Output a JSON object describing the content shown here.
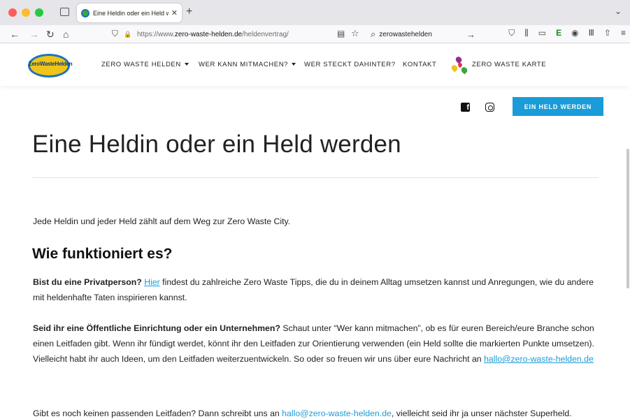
{
  "browser": {
    "tab_title": "Eine Heldin oder ein Held werde",
    "tab_close": "✕",
    "new_tab": "+",
    "tab_list": "⌄",
    "url_prefix": "https://www.",
    "url_domain": "zero-waste-helden.de",
    "url_path": "/heldenvertrag/",
    "search_text": "zerowastehelden",
    "nav_icons": {
      "back": "←",
      "forward": "→",
      "reload": "↻",
      "home": "⌂",
      "shield": "⛉",
      "lock": "🔒",
      "reader": "▤",
      "star": "☆",
      "search": "⌕",
      "go": "→"
    },
    "right_icons": [
      "⛉",
      "⫼",
      "▭",
      "E",
      "◉",
      "Ⅲ",
      "⇧",
      "≡"
    ]
  },
  "site": {
    "logo_text": "ZeroWasteHelden",
    "menu": [
      {
        "label": "ZERO WASTE HELDEN",
        "has_caret": true
      },
      {
        "label": "WER KANN MITMACHEN?",
        "has_caret": true
      },
      {
        "label": "WER STECKT DAHINTER?",
        "has_caret": false
      },
      {
        "label": "KONTAKT",
        "has_caret": false
      },
      {
        "label": "ZERO WASTE KARTE",
        "has_caret": false
      }
    ],
    "map_drop_colors": [
      "#9b2a8a",
      "#f0c419",
      "#e2325a",
      "#3aa63a"
    ],
    "social": {
      "facebook": "f"
    },
    "cta_label": "EIN HELD WERDEN"
  },
  "content": {
    "title": "Eine Heldin oder ein Held werden",
    "intro": "Jede Heldin und jeder Held zählt auf dem Weg zur Zero Waste City.",
    "heading": "Wie funktioniert es?",
    "p1_bold": "Bist du eine Privatperson?",
    "p1_link": "Hier",
    "p1_rest": " findest du zahlreiche Zero Waste Tipps, die du in deinem Alltag umsetzen kannst und Anregungen, wie du andere mit heldenhafte Taten inspirieren kannst.",
    "p2_bold": "Seid ihr eine Öffentliche Einrichtung oder ein Unternehmen?",
    "p2_rest": " Schaut unter “Wer kann mitmachen”, ob es für euren Bereich/eure Branche schon einen Leitfaden gibt. Wenn ihr fündigt werdet, könnt ihr den Leitfaden zur Orientierung verwenden (ein Held sollte die markierten Punkte umset­zen). Vielleicht habt ihr auch Ideen, um den Leitfaden weiterzuentwickeln. So oder so freuen wir uns über eure Nachricht an ",
    "p2_link": "hallo@zero-waste-helden.de",
    "p3_start": "Gibt es noch keinen passenden Leitfaden? Dann schreibt uns an ",
    "p3_link": "hallo@zero-waste-helden.de",
    "p3_end": ", vielleicht seid ihr ja unser nächster Superheld."
  },
  "colors": {
    "accent": "#1a9cd8",
    "logo_yellow": "#f0c419",
    "logo_blue": "#1b75bb"
  }
}
